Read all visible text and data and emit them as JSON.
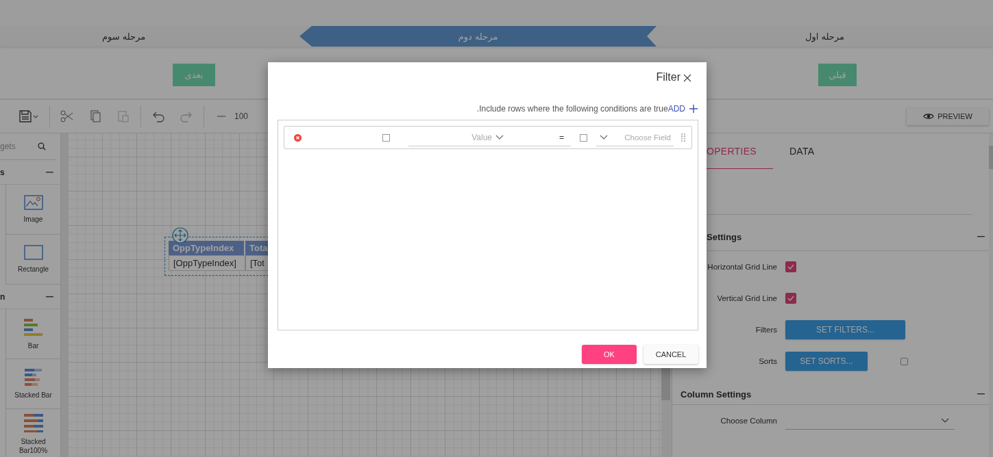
{
  "steps": [
    {
      "label": "مرحله اول",
      "selected": false
    },
    {
      "label": "مرحله دوم",
      "selected": true
    },
    {
      "label": "مرحله سوم",
      "selected": false
    }
  ],
  "nav_buttons": {
    "next": "بعدی",
    "previous": "قبلی"
  },
  "toolbar": {
    "zoom": "100",
    "preview": "PREVIEW"
  },
  "widgets": {
    "search_placeholder": "gets",
    "sections": [
      {
        "title": "s",
        "items": [
          {
            "label": "Image",
            "kind": "image"
          },
          {
            "label": "Rectangle",
            "kind": "rectangle"
          }
        ]
      },
      {
        "title": "n",
        "items": [
          {
            "label": "Bar",
            "kind": "bar"
          },
          {
            "label": "Stacked Bar",
            "kind": "stacked"
          },
          {
            "label": "Stacked Bar100%",
            "kind": "stacked100"
          }
        ]
      }
    ]
  },
  "canvas_table": {
    "headers": [
      "OppTypeIndex",
      "Tota"
    ],
    "cells": [
      "[OppTypeIndex]",
      "[Tot"
    ]
  },
  "properties": {
    "tabs": [
      {
        "label": "OPERTIES",
        "selected": true
      },
      {
        "label": "DATA",
        "selected": false
      }
    ],
    "grid_section": {
      "title": "Settings",
      "rows": [
        {
          "kind": "checkbox",
          "label": "Horizontal Grid Line",
          "checked": true
        },
        {
          "kind": "checkbox",
          "label": "Vertical Grid Line",
          "checked": true
        },
        {
          "kind": "action",
          "label": "Filters",
          "button": "SET FILTERS..."
        },
        {
          "kind": "sort",
          "label": "Sorts",
          "button": "SET SORTS...",
          "checked": false
        }
      ]
    },
    "column_section": {
      "title": "Column Settings",
      "field_label": "Choose Column"
    }
  },
  "dialog": {
    "title": "Filter",
    "description": ".Include rows where the following conditions are true",
    "add": "ADD",
    "conditions": [
      {
        "field_placeholder": "Choose Field",
        "field_checked": false,
        "operator": "=",
        "value_placeholder": "Value",
        "value_checked": false
      }
    ],
    "ok": "OK",
    "cancel": "CANCEL"
  }
}
